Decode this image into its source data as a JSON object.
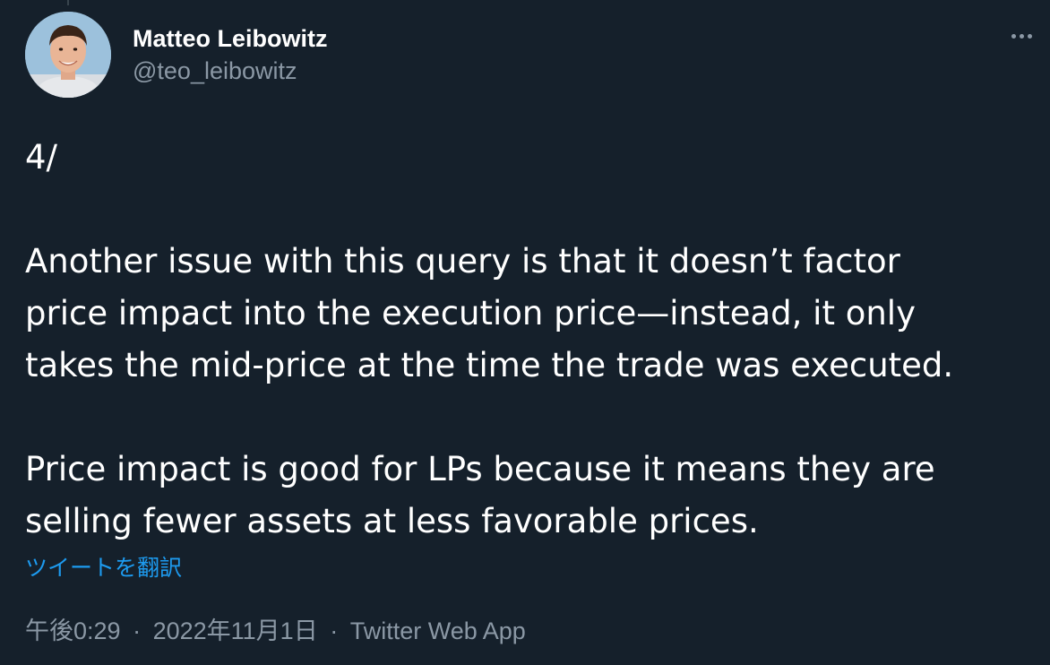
{
  "author": {
    "display_name": "Matteo Leibowitz",
    "handle": "@teo_leibowitz"
  },
  "tweet": {
    "text_paragraphs": [
      "4/",
      "Another issue with this query is that it doesn’t factor\nprice impact into the execution price—instead, it only\ntakes the mid-price at the time the trade was executed.",
      "Price impact is good for LPs because it means they are\nselling fewer assets at less favorable prices."
    ],
    "translate_label": "ツイートを翻訳"
  },
  "meta": {
    "time": "午後0:29",
    "separator": "·",
    "date": "2022年11月1日",
    "source": "Twitter Web App"
  },
  "icons": {
    "more": "more-horizontal-icon"
  },
  "colors": {
    "background": "#15202b",
    "primary_text": "#ffffff",
    "secondary_text": "#8b98a5",
    "link": "#1d9bf0"
  }
}
